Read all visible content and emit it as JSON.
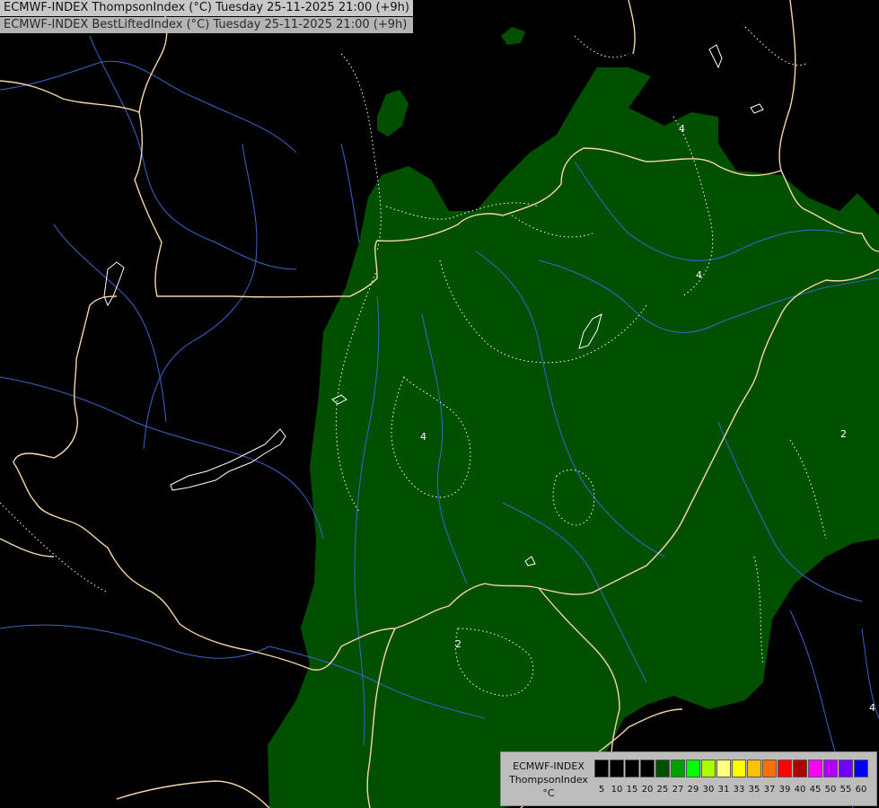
{
  "title": {
    "line1": "ECMWF-INDEX ThompsonIndex (°C) Tuesday 25-11-2025 21:00 (+9h)",
    "line2": "ECMWF-INDEX BestLiftedIndex (°C) Tuesday 25-11-2025 21:00 (+9h)"
  },
  "map": {
    "background_color": "#000000",
    "field_color": "#005000",
    "border_color": "#f5d7a8",
    "river_color": "#3c64c8",
    "contour_color": "#ffffff",
    "contour_labels": [
      {
        "text": "4"
      },
      {
        "text": "4"
      },
      {
        "text": "4"
      },
      {
        "text": "2"
      },
      {
        "text": "2"
      },
      {
        "text": "4"
      }
    ]
  },
  "legend": {
    "label_line1": "ECMWF-INDEX",
    "label_line2": "ThompsonIndex",
    "label_line3": "°C",
    "swatches": [
      {
        "color": "#000000"
      },
      {
        "color": "#000000"
      },
      {
        "color": "#000000"
      },
      {
        "color": "#000000"
      },
      {
        "color": "#005000"
      },
      {
        "color": "#00a000"
      },
      {
        "color": "#00ff00"
      },
      {
        "color": "#aaff00"
      },
      {
        "color": "#ffff80"
      },
      {
        "color": "#ffff00"
      },
      {
        "color": "#ffc000"
      },
      {
        "color": "#ff7000"
      },
      {
        "color": "#ff0000"
      },
      {
        "color": "#b00000"
      },
      {
        "color": "#ff00ff"
      },
      {
        "color": "#b000ff"
      },
      {
        "color": "#7000ff"
      },
      {
        "color": "#0000ff"
      }
    ],
    "ticks": [
      "5",
      "10",
      "15",
      "20",
      "25",
      "27",
      "29",
      "30",
      "31",
      "33",
      "35",
      "37",
      "39",
      "40",
      "45",
      "50",
      "55",
      "60"
    ]
  }
}
